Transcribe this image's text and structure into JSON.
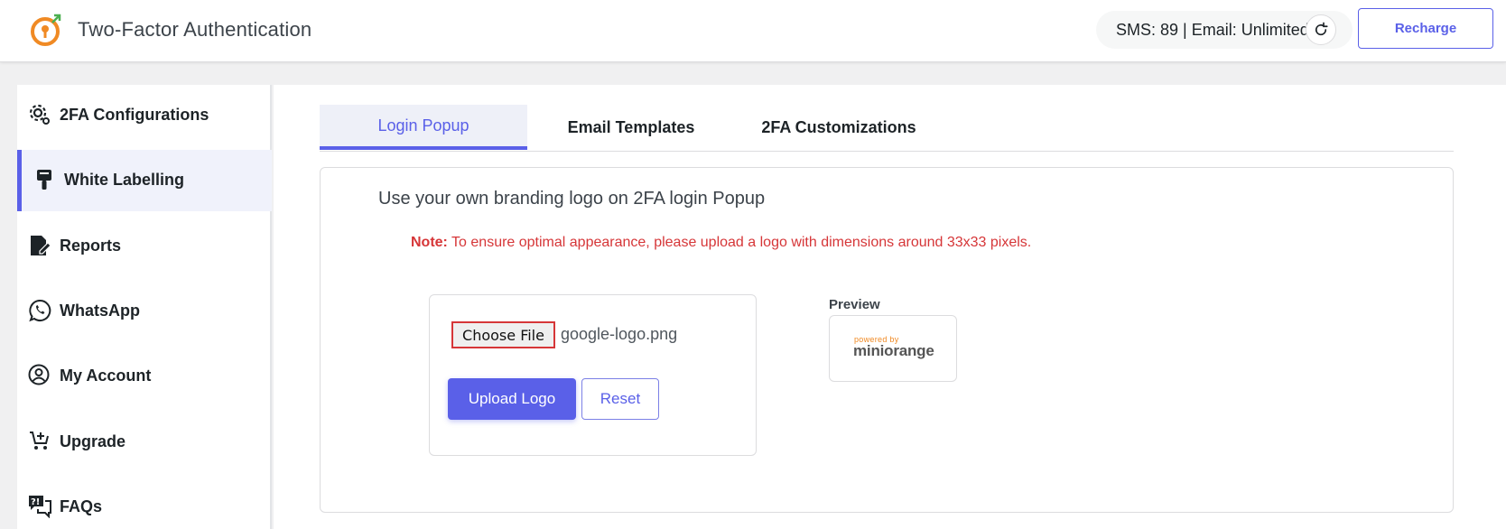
{
  "header": {
    "app_title": "Two-Factor Authentication",
    "credits": "SMS: 89 | Email: Unlimited",
    "recharge_label": "Recharge",
    "logo_icon": "key-shield-icon",
    "accent_color": "#f08a24"
  },
  "sidebar": {
    "items": [
      {
        "label": "2FA Configurations",
        "icon": "gear-cog-icon"
      },
      {
        "label": "White Labelling",
        "icon": "paint-roller-icon"
      },
      {
        "label": "Reports",
        "icon": "file-chart-icon"
      },
      {
        "label": "WhatsApp",
        "icon": "whatsapp-icon"
      },
      {
        "label": "My Account",
        "icon": "user-circle-icon"
      },
      {
        "label": "Upgrade",
        "icon": "cart-plus-icon"
      },
      {
        "label": "FAQs",
        "icon": "question-chat-icon"
      }
    ],
    "active_index": 1
  },
  "tabs": [
    {
      "label": "Login Popup"
    },
    {
      "label": "Email Templates"
    },
    {
      "label": "2FA Customizations"
    }
  ],
  "content": {
    "section_title": "Use your own branding logo on 2FA login Popup",
    "note_label": "Note:",
    "note_text": " To ensure optimal appearance, please upload a logo with dimensions around 33x33 pixels.",
    "choose_file_label": "Choose File",
    "file_name": "google-logo.png",
    "upload_label": "Upload Logo",
    "reset_label": "Reset",
    "preview_label": "Preview",
    "preview_powered": "powered by",
    "preview_brand": "miniorange"
  },
  "colors": {
    "primary": "#5a60e8",
    "danger": "#d63638",
    "brand_orange": "#f08a24"
  }
}
